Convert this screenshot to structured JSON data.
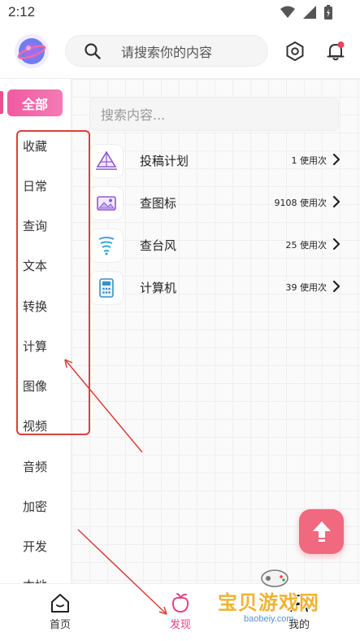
{
  "status_bar": {
    "time": "2:12"
  },
  "header": {
    "search_placeholder": "请搜索你的内容",
    "icons": [
      "avatar-planet-icon",
      "search-icon",
      "settings-hexagon-icon",
      "bell-icon"
    ]
  },
  "sidebar": {
    "active": "全部",
    "items": [
      "收藏",
      "日常",
      "查询",
      "文本",
      "转换",
      "计算",
      "图像",
      "视频",
      "音频",
      "加密",
      "开发",
      "本地"
    ]
  },
  "content": {
    "search_placeholder": "搜索内容...",
    "tools": [
      {
        "name": "投稿计划",
        "count": "1 使用次",
        "icon": "tent-icon"
      },
      {
        "name": "查图标",
        "count": "9108 使用次",
        "icon": "image-icon"
      },
      {
        "name": "查台风",
        "count": "25 使用次",
        "icon": "typhoon-icon"
      },
      {
        "name": "计算机",
        "count": "39 使用次",
        "icon": "calculator-icon"
      }
    ]
  },
  "bottom_nav": {
    "items": [
      {
        "label": "首页",
        "icon": "home-icon"
      },
      {
        "label": "发现",
        "icon": "peach-icon"
      },
      {
        "label": "我的",
        "icon": "user-icon"
      }
    ]
  },
  "watermark": {
    "title": "宝贝游戏网",
    "url": "baobeiy.com"
  },
  "colors": {
    "accent": "#ef4d8f",
    "fab": "#f0697e",
    "annotation": "#d9403a"
  }
}
